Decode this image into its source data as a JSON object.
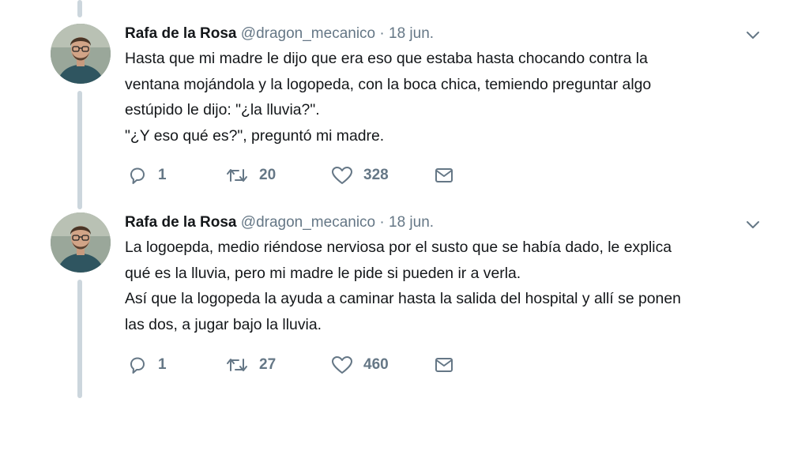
{
  "tweets": [
    {
      "name": "Rafa de la Rosa",
      "handle": "@dragon_mecanico",
      "separator": "·",
      "date": "18 jun.",
      "lines": [
        "Hasta que mi madre le dijo que era eso que estaba hasta chocando contra la",
        "ventana mojándola y la logopeda, con la boca chica, temiendo preguntar algo",
        "estúpido le dijo: \"¿la lluvia?\".",
        "\"¿Y eso qué es?\", preguntó mi madre."
      ],
      "replies": "1",
      "retweets": "20",
      "likes": "328"
    },
    {
      "name": "Rafa de la Rosa",
      "handle": "@dragon_mecanico",
      "separator": "·",
      "date": "18 jun.",
      "lines": [
        "La logoepda, medio riéndose nerviosa por el susto que se había dado, le explica",
        "qué es la lluvia, pero mi madre le pide si pueden ir a verla.",
        "Así que la logopeda la ayuda a caminar hasta la salida del hospital y allí se ponen",
        "las dos, a jugar bajo la lluvia."
      ],
      "replies": "1",
      "retweets": "27",
      "likes": "460"
    }
  ],
  "colors": {
    "text": "#14171a",
    "secondary": "#657786",
    "thread_line": "#ccd6dd"
  },
  "icons": [
    "chevron-down-icon",
    "reply-icon",
    "retweet-icon",
    "like-icon",
    "message-icon"
  ]
}
